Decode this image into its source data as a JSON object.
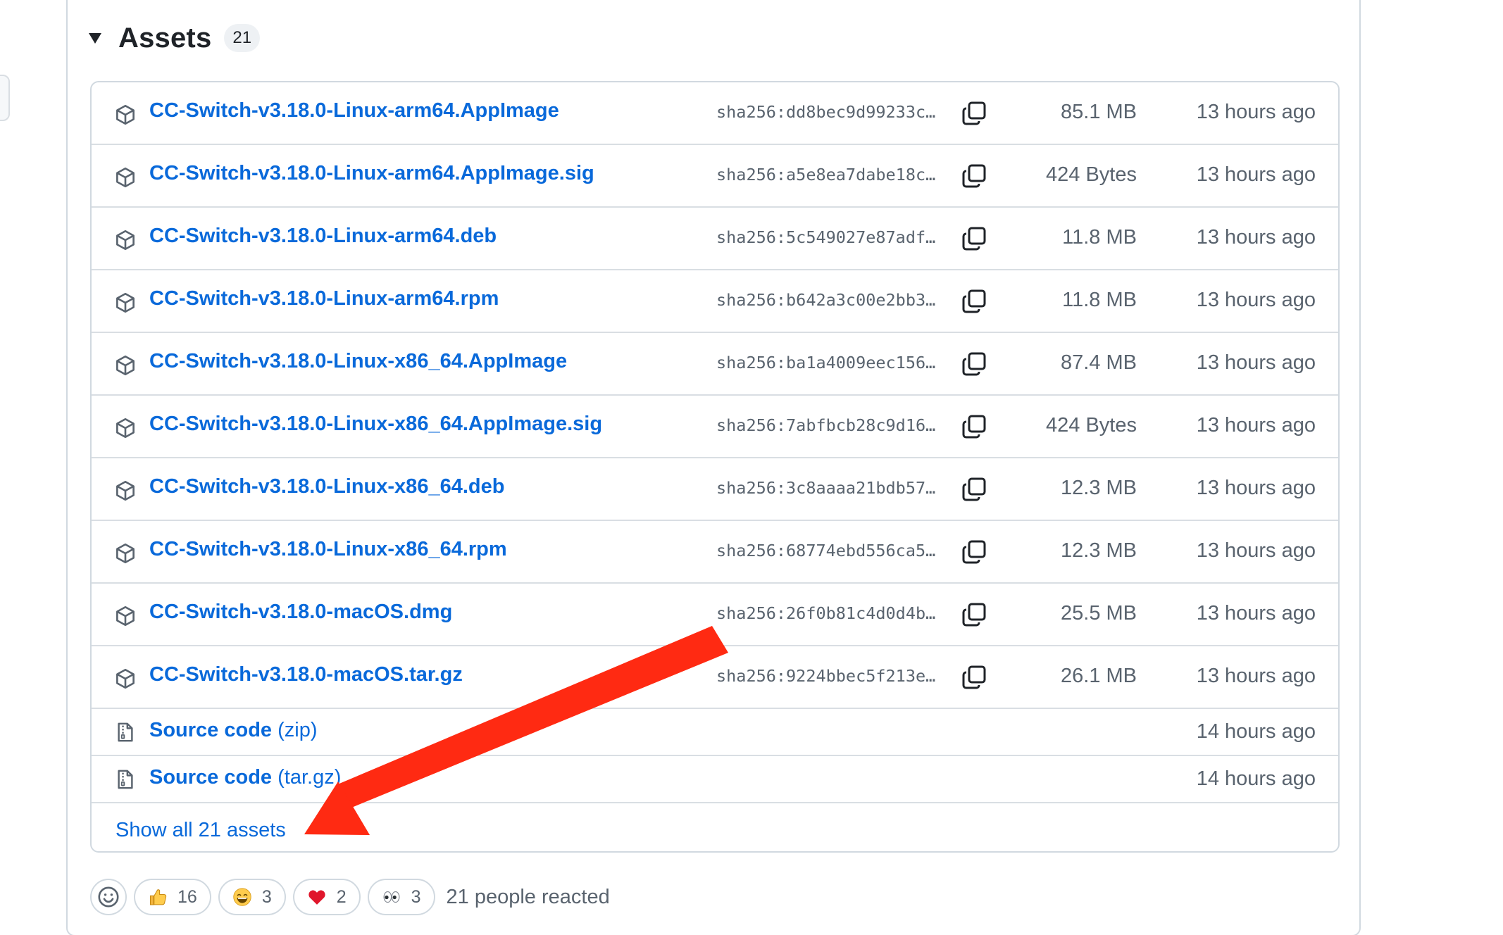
{
  "assets": {
    "title": "Assets",
    "count": "21",
    "rows": [
      {
        "name": "CC-Switch-v3.18.0-Linux-arm64.AppImage",
        "sha": "sha256:dd8bec9d99233c…",
        "size": "85.1 MB",
        "time": "13 hours ago"
      },
      {
        "name": "CC-Switch-v3.18.0-Linux-arm64.AppImage.sig",
        "sha": "sha256:a5e8ea7dabe18c…",
        "size": "424 Bytes",
        "time": "13 hours ago"
      },
      {
        "name": "CC-Switch-v3.18.0-Linux-arm64.deb",
        "sha": "sha256:5c549027e87adf…",
        "size": "11.8 MB",
        "time": "13 hours ago"
      },
      {
        "name": "CC-Switch-v3.18.0-Linux-arm64.rpm",
        "sha": "sha256:b642a3c00e2bb3…",
        "size": "11.8 MB",
        "time": "13 hours ago"
      },
      {
        "name": "CC-Switch-v3.18.0-Linux-x86_64.AppImage",
        "sha": "sha256:ba1a4009eec156…",
        "size": "87.4 MB",
        "time": "13 hours ago"
      },
      {
        "name": "CC-Switch-v3.18.0-Linux-x86_64.AppImage.sig",
        "sha": "sha256:7abfbcb28c9d16…",
        "size": "424 Bytes",
        "time": "13 hours ago"
      },
      {
        "name": "CC-Switch-v3.18.0-Linux-x86_64.deb",
        "sha": "sha256:3c8aaaa21bdb57…",
        "size": "12.3 MB",
        "time": "13 hours ago"
      },
      {
        "name": "CC-Switch-v3.18.0-Linux-x86_64.rpm",
        "sha": "sha256:68774ebd556ca5…",
        "size": "12.3 MB",
        "time": "13 hours ago"
      },
      {
        "name": "CC-Switch-v3.18.0-macOS.dmg",
        "sha": "sha256:26f0b81c4d0d4b…",
        "size": "25.5 MB",
        "time": "13 hours ago"
      },
      {
        "name": "CC-Switch-v3.18.0-macOS.tar.gz",
        "sha": "sha256:9224bbec5f213e…",
        "size": "26.1 MB",
        "time": "13 hours ago"
      }
    ],
    "source_rows": [
      {
        "name": "Source code",
        "format": "(zip)",
        "time": "14 hours ago"
      },
      {
        "name": "Source code",
        "format": "(tar.gz)",
        "time": "14 hours ago"
      }
    ],
    "show_all": "Show all 21 assets"
  },
  "icons": {
    "disclosure": "triangle-down-icon",
    "asset": "package-icon",
    "source": "file-zip-icon",
    "copy": "copy-icon",
    "add_reaction": "smiley-icon"
  },
  "reactions": {
    "items": [
      {
        "emoji": "thumbs-up",
        "count": "16"
      },
      {
        "emoji": "laugh",
        "count": "3"
      },
      {
        "emoji": "heart",
        "count": "2"
      },
      {
        "emoji": "eyes",
        "count": "3"
      }
    ],
    "summary": "21 people reacted"
  },
  "colors": {
    "link": "#0969da",
    "muted": "#59636e",
    "border": "#d1d9e0",
    "arrow": "#ff2a12"
  }
}
